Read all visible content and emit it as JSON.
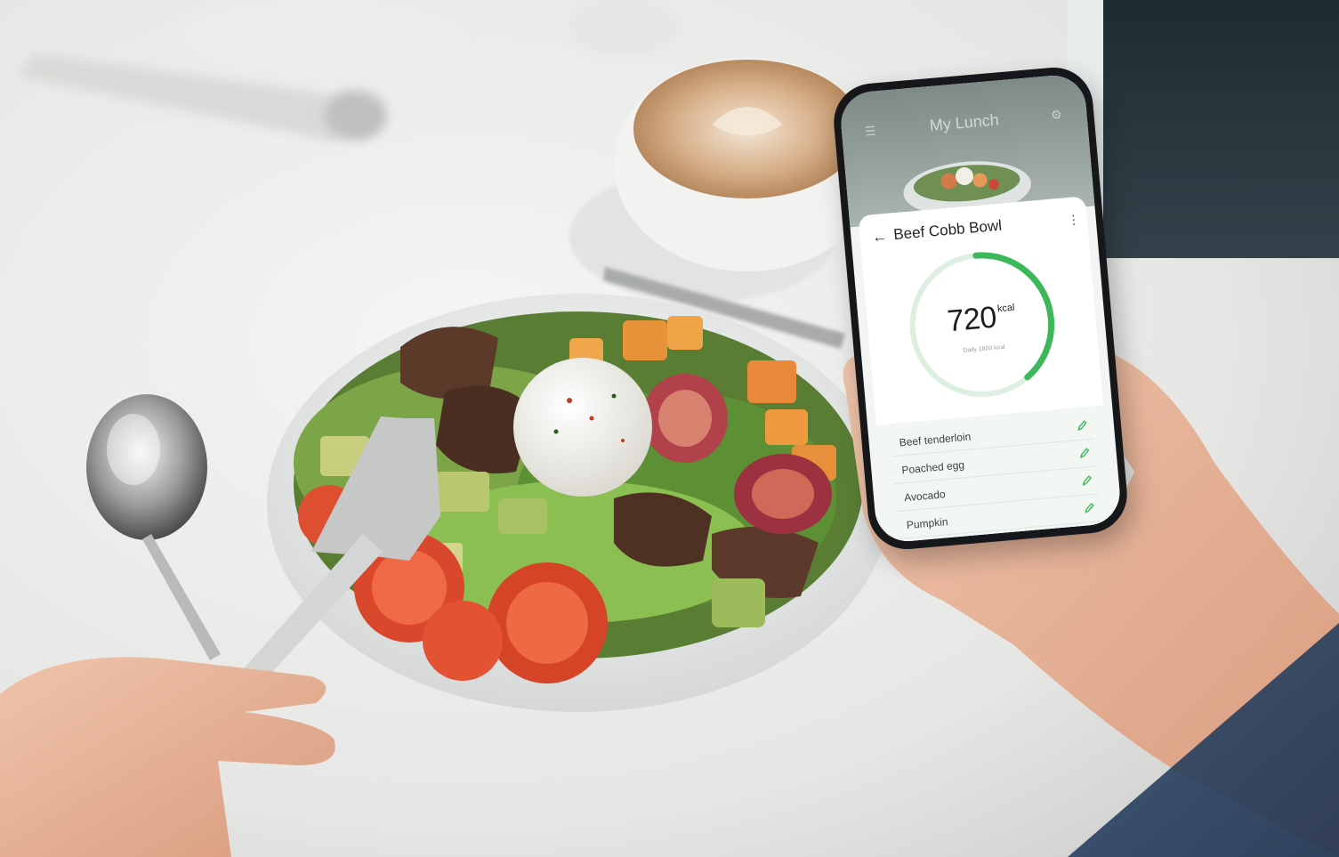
{
  "app": {
    "header_title": "My Lunch",
    "dish_name": "Beef Cobb Bowl",
    "calories": {
      "value": "720",
      "unit": "kcal",
      "daily_label": "Daily 1800 kcal",
      "progress_fraction": 0.4
    },
    "ingredients": [
      {
        "label": "Beef tenderloin"
      },
      {
        "label": "Poached egg"
      },
      {
        "label": "Avocado"
      },
      {
        "label": "Pumpkin"
      }
    ],
    "icons": {
      "back": "arrow-left-icon",
      "more": "more-vertical-icon",
      "edit": "pencil-icon",
      "menu": "menu-icon",
      "settings": "gear-icon"
    },
    "colors": {
      "accent": "#3cb85a",
      "ring_track": "#dcefe1",
      "list_bg": "#f2f7f3"
    }
  }
}
